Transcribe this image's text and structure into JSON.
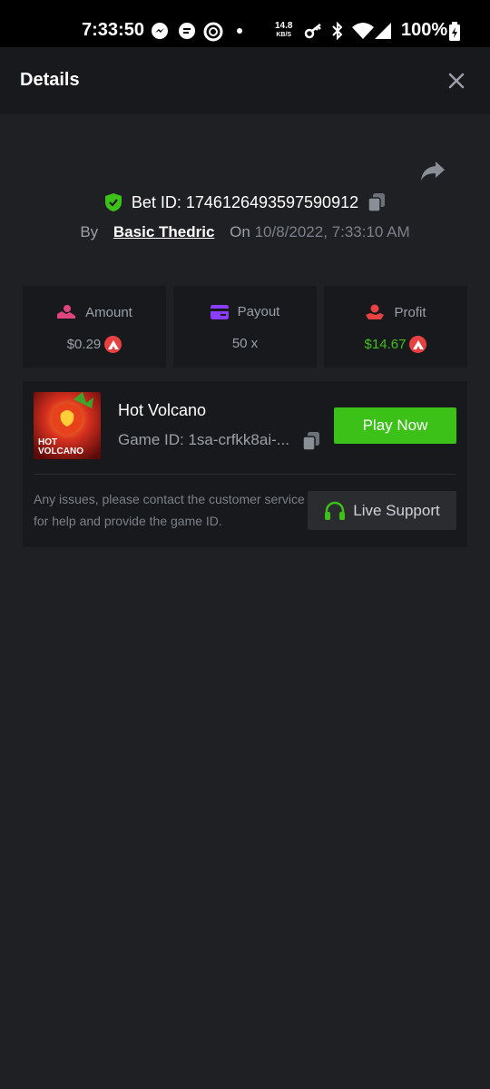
{
  "status_bar": {
    "time": "7:33:50",
    "net_speed": "14.8",
    "net_unit": "KB/S",
    "battery": "100%"
  },
  "header": {
    "title": "Details"
  },
  "bet": {
    "id_text": "Bet ID: 1746126493597590912",
    "by_label": "By",
    "user": "Basic Thedric",
    "on_label": "On",
    "date": "10/8/2022, 7:33:10 AM"
  },
  "stats": {
    "amount": {
      "label": "Amount",
      "value": "$0.29"
    },
    "payout": {
      "label": "Payout",
      "value": "50 x"
    },
    "profit": {
      "label": "Profit",
      "value": "$14.67"
    }
  },
  "game": {
    "name": "Hot Volcano",
    "id_text": "Game ID: 1sa-crfkk8ai-...",
    "thumb_text_line1": "HOT",
    "thumb_text_line2": "VOLCANO",
    "play_label": "Play Now",
    "notice": "Any issues, please contact the customer service for help and provide the game ID.",
    "support_label": "Live Support"
  },
  "colors": {
    "background": "#1f2023",
    "panel": "#18191c",
    "accent_green": "#3bc117",
    "profit_green": "#3bc117",
    "coin_red": "#e84142",
    "amount_icon": "#e0457b",
    "payout_icon": "#8b3dff",
    "profit_icon": "#e84142"
  }
}
